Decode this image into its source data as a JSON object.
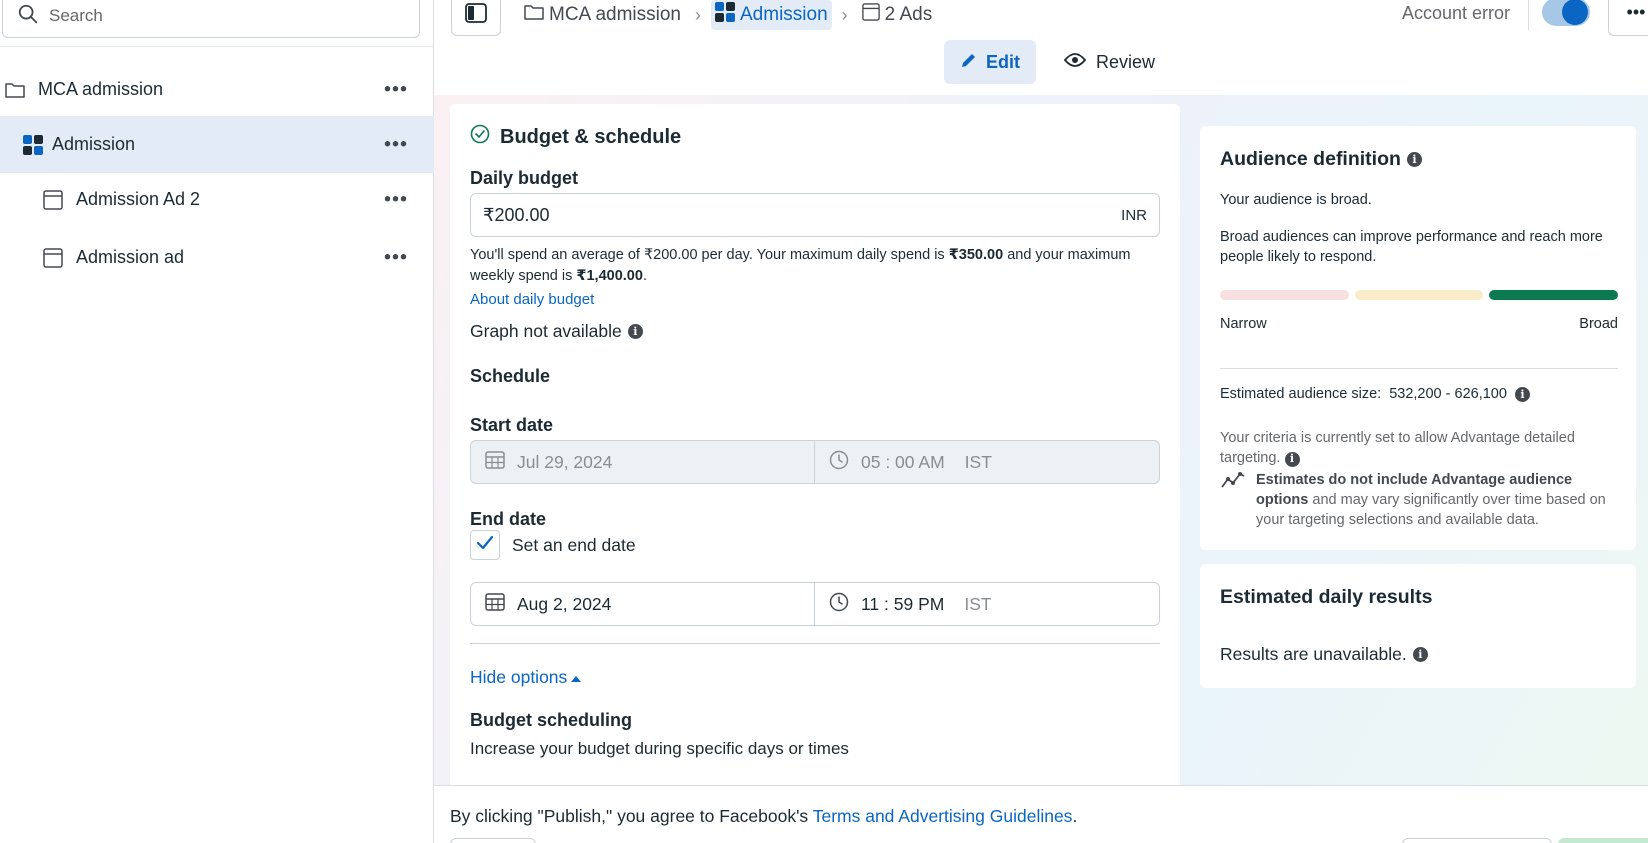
{
  "sidebar": {
    "search_placeholder": "Search",
    "items": [
      {
        "label": "MCA admission",
        "icon": "folder-icon",
        "more": "•••"
      },
      {
        "label": "Admission",
        "icon": "adset-grid-icon",
        "more": "•••"
      },
      {
        "label": "Admission Ad 2",
        "icon": "ad-icon",
        "more": "•••"
      },
      {
        "label": "Admission ad",
        "icon": "ad-icon",
        "more": "•••"
      }
    ]
  },
  "topbar": {
    "breadcrumbs": [
      "MCA admission",
      "Admission",
      "2 Ads"
    ],
    "account_error": "Account error",
    "more": "•••",
    "edit_label": "Edit",
    "review_label": "Review"
  },
  "budget": {
    "section_title": "Budget & schedule",
    "daily_budget_label": "Daily budget",
    "daily_budget_value": "₹200.00",
    "currency": "INR",
    "spend_p1": "You'll spend an average of ₹200.00 per day. Your maximum daily spend is ",
    "spend_max_daily": "₹350.00",
    "spend_p2": " and your maximum weekly spend is ",
    "spend_max_weekly": "₹1,400.00",
    "spend_p3": ".",
    "about_link": "About daily budget",
    "graph_na": "Graph not available",
    "schedule_label": "Schedule",
    "start_date_label": "Start date",
    "start_date": "Jul 29, 2024",
    "start_time": "05 : 00 AM",
    "start_tz": "IST",
    "end_date_label": "End date",
    "set_end_date_label": "Set an end date",
    "end_date": "Aug 2, 2024",
    "end_time": "11 : 59 PM",
    "end_tz": "IST",
    "hide_options": "Hide options",
    "budget_scheduling_label": "Budget scheduling",
    "budget_scheduling_text": "Increase your budget during specific days or times"
  },
  "audience": {
    "title": "Audience definition",
    "broad": "Your audience is broad.",
    "broad_desc": "Broad audiences can improve performance and reach more people likely to respond.",
    "narrow_label": "Narrow",
    "broad_label": "Broad",
    "est_label": "Estimated audience size:",
    "est_value": "532,200 - 626,100",
    "criteria": "Your criteria is currently set to allow Advantage detailed targeting.",
    "note_bold": "Estimates do not include Advantage audience options",
    "note_rest": " and may vary significantly over time based on your targeting selections and available data.",
    "colors": {
      "narrow": "#f8dfe0",
      "mid": "#fbecc9",
      "broad": "#0b7a53"
    }
  },
  "results": {
    "title": "Estimated daily results",
    "unavailable": "Results are unavailable."
  },
  "footer": {
    "text_prefix": "By clicking \"Publish,\" you agree to Facebook's ",
    "link": "Terms and Advertising Guidelines",
    "text_suffix": "."
  }
}
